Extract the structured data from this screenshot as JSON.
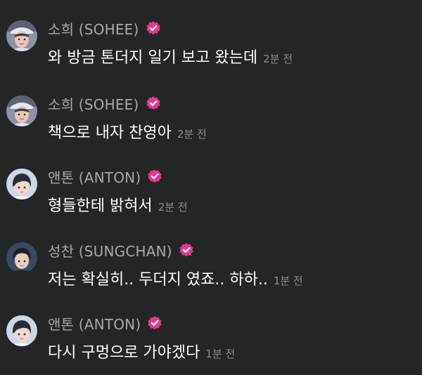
{
  "colors": {
    "background": "#242526",
    "name": "#a9aaae",
    "message": "#ffffff",
    "timestamp": "#8d8e92",
    "verified_badge": "#e6388f"
  },
  "messages": [
    {
      "author": "소희 (SOHEE)",
      "avatar_icon": "sohee-avatar-icon",
      "verified": true,
      "text": "와 방금 톤더지 일기 보고 왔는데",
      "time": "2분 전"
    },
    {
      "author": "소희 (SOHEE)",
      "avatar_icon": "sohee-avatar-icon",
      "verified": true,
      "text": "책으로 내자 찬영아",
      "time": "2분 전"
    },
    {
      "author": "앤톤 (ANTON)",
      "avatar_icon": "anton-avatar-icon",
      "verified": true,
      "text": "형들한테 밝혀서",
      "time": "2분 전"
    },
    {
      "author": "성찬 (SUNGCHAN)",
      "avatar_icon": "sungchan-avatar-icon",
      "verified": true,
      "text": "저는 확실히.. 두더지 였죠.. 하하..",
      "time": "1분 전"
    },
    {
      "author": "앤톤 (ANTON)",
      "avatar_icon": "anton-avatar-icon",
      "verified": true,
      "text": "다시 구멍으로 가야겠다",
      "time": "1분 전"
    }
  ]
}
